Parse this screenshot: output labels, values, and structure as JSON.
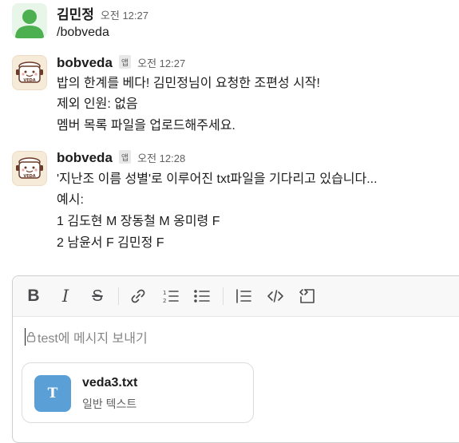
{
  "messages": [
    {
      "sender": "김민정",
      "time": "오전 12:27",
      "lines": [
        "/bobveda"
      ]
    },
    {
      "sender": "bobveda",
      "badge": "앱",
      "time": "오전 12:27",
      "avatar_text": "VEDA",
      "lines": [
        "밥의 한계를 베다! 김민정님이 요청한 조편성 시작!",
        "제외 인원: 없음",
        "멤버 목록 파일을 업로드해주세요."
      ]
    },
    {
      "sender": "bobveda",
      "badge": "앱",
      "time": "오전 12:28",
      "avatar_text": "VEDA",
      "lines": [
        "'지난조 이름 성별'로 이루어진 txt파일을 기다리고 있습니다...",
        "예시:",
        "1 김도현 M 장동철 M 옹미령 F",
        "2 남윤서 F 김민정 F"
      ]
    }
  ],
  "composer": {
    "toolbar": {
      "bold": "B",
      "italic": "I",
      "strike": "S"
    },
    "placeholder": "test에 메시지 보내기",
    "attachment": {
      "icon_letter": "T",
      "name": "veda3.txt",
      "type": "일반 텍스트"
    }
  },
  "colors": {
    "user_avatar": "#4caf50",
    "file_icon": "#5a9fd6",
    "bot_avatar_bg": "#f6ead9"
  },
  "icons": [
    "person-icon",
    "rice-cooker-icon",
    "link-icon",
    "numbered-list-icon",
    "bulleted-list-icon",
    "blockquote-icon",
    "code-icon",
    "code-block-icon",
    "lock-icon",
    "text-file-icon"
  ]
}
